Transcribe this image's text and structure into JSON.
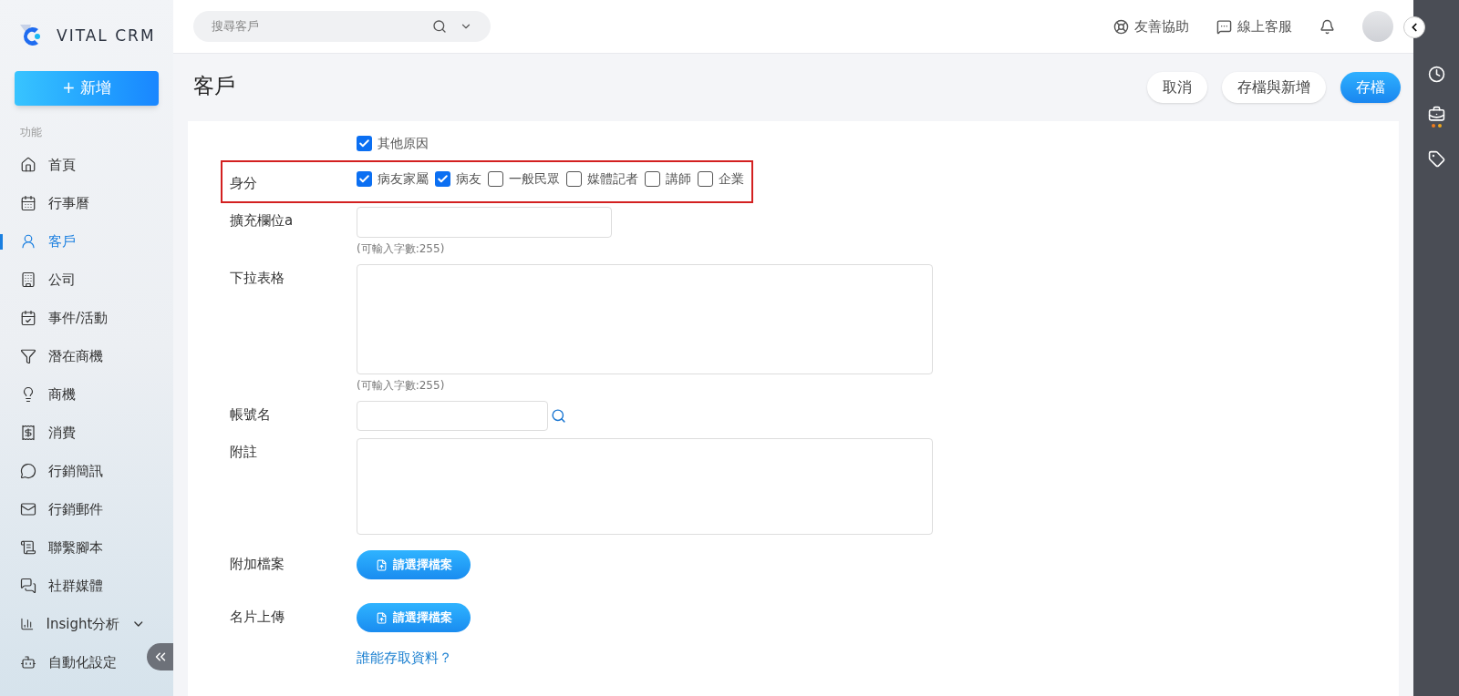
{
  "brand": {
    "name": "VITAL CRM"
  },
  "sidebar": {
    "new_button": "+ 新增",
    "section_label": "功能",
    "items": [
      {
        "label": "首頁",
        "selected": false,
        "expandable": false
      },
      {
        "label": "行事曆",
        "selected": false,
        "expandable": false
      },
      {
        "label": "客戶",
        "selected": true,
        "expandable": false
      },
      {
        "label": "公司",
        "selected": false,
        "expandable": false
      },
      {
        "label": "事件/活動",
        "selected": false,
        "expandable": false
      },
      {
        "label": "潛在商機",
        "selected": false,
        "expandable": false
      },
      {
        "label": "商機",
        "selected": false,
        "expandable": false
      },
      {
        "label": "消費",
        "selected": false,
        "expandable": false
      },
      {
        "label": "行銷簡訊",
        "selected": false,
        "expandable": false
      },
      {
        "label": "行銷郵件",
        "selected": false,
        "expandable": false
      },
      {
        "label": "聯繫腳本",
        "selected": false,
        "expandable": false
      },
      {
        "label": "社群媒體",
        "selected": false,
        "expandable": false
      },
      {
        "label": "Insight分析",
        "selected": false,
        "expandable": true
      },
      {
        "label": "自動化設定",
        "selected": false,
        "expandable": false
      }
    ]
  },
  "topbar": {
    "search": {
      "placeholder": "搜尋客戶"
    },
    "links": [
      "友善協助",
      "線上客服"
    ]
  },
  "page": {
    "title": "客戶",
    "buttons": [
      {
        "label": "取消",
        "kind": "plain"
      },
      {
        "label": "存檔與新增",
        "kind": "plain"
      },
      {
        "label": "存檔",
        "kind": "primary"
      }
    ]
  },
  "form": {
    "fields": [
      {
        "kind": "checkboxes",
        "highlighted": false,
        "options": [
          {
            "label": "其他原因",
            "checked": true
          }
        ]
      },
      {
        "kind": "checkboxes",
        "label": "身分",
        "highlighted": true,
        "options": [
          {
            "label": "病友家屬",
            "checked": true
          },
          {
            "label": "病友",
            "checked": true
          },
          {
            "label": "一般民眾",
            "checked": false
          },
          {
            "label": "媒體記者",
            "checked": false
          },
          {
            "label": "講師",
            "checked": false
          },
          {
            "label": "企業",
            "checked": false
          }
        ]
      },
      {
        "kind": "text",
        "label": "擴充欄位a",
        "highlighted": false,
        "hint": "(可輸入字數:255)"
      },
      {
        "kind": "textarea",
        "label": "下拉表格",
        "highlighted": false,
        "hint": "(可輸入字數:255)"
      },
      {
        "kind": "lookup",
        "label": "帳號名",
        "highlighted": false
      },
      {
        "kind": "textarea",
        "label": "附註",
        "highlighted": false
      },
      {
        "kind": "file",
        "label": "附加檔案",
        "highlighted": false,
        "button": "請選擇檔案"
      },
      {
        "kind": "file",
        "label": "名片上傳",
        "highlighted": false,
        "button": "請選擇檔案"
      }
    ],
    "access_link": "誰能存取資料？"
  }
}
